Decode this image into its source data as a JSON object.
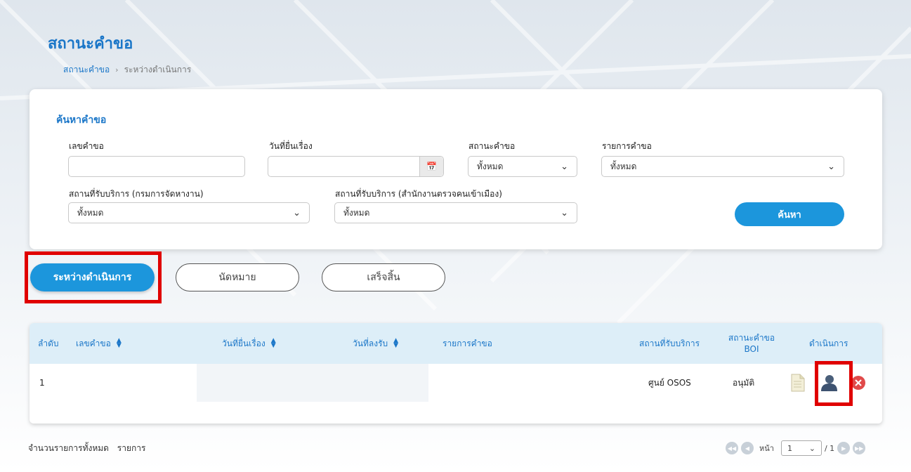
{
  "page": {
    "title": "สถานะคำขอ",
    "breadcrumb": {
      "root": "สถานะคำขอ",
      "separator": "›",
      "current": "ระหว่างดำเนินการ"
    }
  },
  "search": {
    "title": "ค้นหาคำขอ",
    "request_no_label": "เลขคำขอ",
    "request_no_value": "",
    "filed_date_label": "วันที่ยื่นเรื่อง",
    "filed_date_value": "",
    "status_label": "สถานะคำขอ",
    "status_value": "ทั้งหมด",
    "request_type_label": "รายการคำขอ",
    "request_type_value": "ทั้งหมด",
    "service_doe_label": "สถานที่รับบริการ (กรมการจัดหางาน)",
    "service_doe_value": "ทั้งหมด",
    "service_imm_label": "สถานที่รับบริการ (สำนักงานตรวจคนเข้าเมือง)",
    "service_imm_value": "ทั้งหมด",
    "search_button": "ค้นหา"
  },
  "tabs": [
    {
      "label": "ระหว่างดำเนินการ",
      "active": true
    },
    {
      "label": "นัดหมาย",
      "active": false
    },
    {
      "label": "เสร็จสิ้น",
      "active": false
    }
  ],
  "table": {
    "columns": {
      "index": "ลำดับ",
      "request_no": "เลขคำขอ",
      "filed_date": "วันที่ยื่นเรื่อง",
      "registered_date": "วันที่ลงรับ",
      "request_type": "รายการคำขอ",
      "service_place": "สถานที่รับบริการ",
      "boi_status_line1": "สถานะคำขอ",
      "boi_status_line2": "BOI",
      "actions": "ดำเนินการ"
    },
    "rows": [
      {
        "index": "1",
        "request_no": "",
        "filed_date": "",
        "registered_date": "",
        "request_type": "",
        "service_place": "ศูนย์ OSOS",
        "boi_status": "อนุมัติ"
      }
    ]
  },
  "footer": {
    "total_label": "จำนวนรายการทั้งหมด",
    "total_value": "",
    "total_unit": "รายการ",
    "page_label": "หน้า",
    "page_value": "1",
    "page_total": "/ 1"
  },
  "colors": {
    "accent": "#1c96dc",
    "title_blue": "#1a76c8",
    "highlight_red": "#e00000",
    "header_bg": "#ddeef8"
  }
}
